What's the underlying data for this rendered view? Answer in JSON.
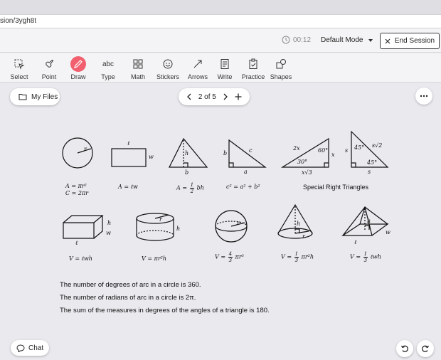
{
  "browser": {
    "url": "sion/3ygh8t"
  },
  "session": {
    "timer": "00:12",
    "mode": "Default Mode",
    "end_label": "End Session"
  },
  "toolbar": {
    "tools": [
      {
        "label": "Select",
        "icon": "select-icon"
      },
      {
        "label": "Point",
        "icon": "point-icon"
      },
      {
        "label": "Draw",
        "icon": "pencil-icon"
      },
      {
        "label": "Type",
        "icon": "type-icon"
      },
      {
        "label": "Math",
        "icon": "math-icon"
      },
      {
        "label": "Stickers",
        "icon": "smiley-icon"
      },
      {
        "label": "Arrows",
        "icon": "arrow-icon"
      },
      {
        "label": "Write",
        "icon": "document-icon"
      },
      {
        "label": "Practice",
        "icon": "clipboard-icon"
      },
      {
        "label": "Shapes",
        "icon": "shapes-icon"
      }
    ],
    "active_color": "#f25f6e"
  },
  "canvas": {
    "my_files": "My Files",
    "page_indicator": "2 of 5",
    "chat": "Chat"
  },
  "reference": {
    "labels": {
      "l": "ℓ",
      "w": "w",
      "h": "h",
      "b": "b",
      "c": "c",
      "a": "a",
      "r": "r",
      "s": "s",
      "two_x": "2x",
      "x": "x",
      "x_sqrt3": "x√3",
      "s_sqrt2": "s√2",
      "deg60": "60°",
      "deg30": "30°",
      "deg45": "45°"
    },
    "formulas": {
      "circle_area": "A = πr²",
      "circle_circ": "C = 2πr",
      "rect_area": "A = ℓw",
      "tri_area_a": "A =",
      "tri_area_num": "1",
      "tri_area_den": "2",
      "tri_area_b": "bh",
      "pythag": "c² = a² + b²",
      "special": "Special Right Triangles",
      "box_vol": "V = ℓwh",
      "cyl_vol": "V = πr²h",
      "sphere_a": "V =",
      "sphere_num": "4",
      "sphere_den": "3",
      "sphere_b": "πr³",
      "cone_a": "V =",
      "cone_num": "1",
      "cone_den": "3",
      "cone_b": "πr²h",
      "pyr_a": "V =",
      "pyr_num": "1",
      "pyr_den": "3",
      "pyr_b": "ℓwh"
    },
    "statements": [
      "The number of degrees of arc in a circle is 360.",
      "The number of radians of arc in a circle is 2π.",
      "The sum of the measures in degrees of the angles of a triangle is 180."
    ]
  }
}
